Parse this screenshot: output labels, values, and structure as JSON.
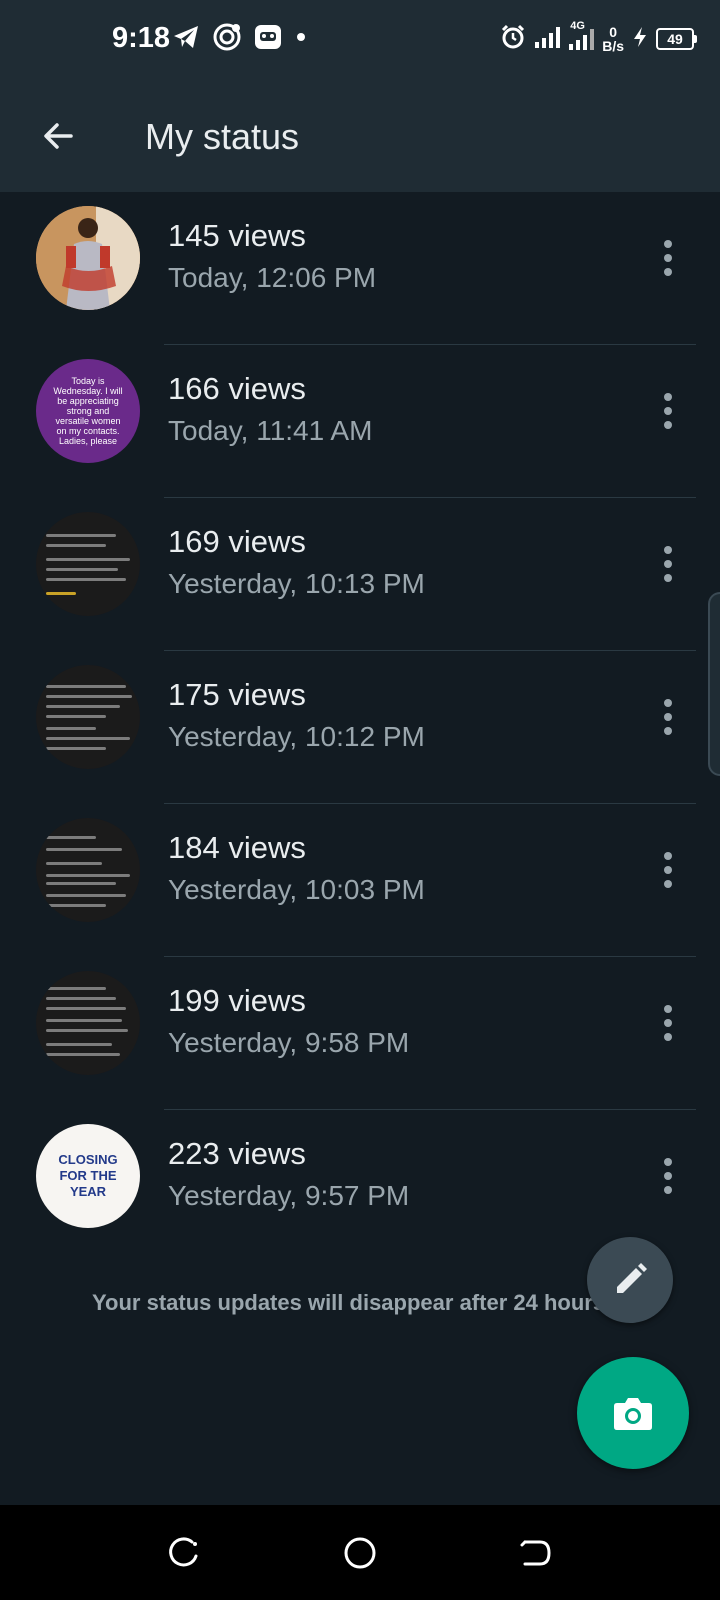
{
  "status_bar": {
    "time": "9:18",
    "network_type": "4G",
    "net_speed_value": "0",
    "net_speed_unit": "B/s",
    "battery": "49",
    "icons": [
      "telegram-icon",
      "ring-app-icon",
      "game-controller-icon",
      "dot-icon",
      "alarm-icon",
      "signal-icon",
      "charging-icon"
    ]
  },
  "app_bar": {
    "title": "My status",
    "back_icon": "arrow-back-icon"
  },
  "statuses": [
    {
      "views": "145 views",
      "time": "Today, 12:06 PM",
      "thumbnail": "photo"
    },
    {
      "views": "166 views",
      "time": "Today, 11:41 AM",
      "thumbnail": "text",
      "thumbnail_text": "Today is Wednesday. I will be appreciating strong and versatile women on my contacts. Ladies, please"
    },
    {
      "views": "169 views",
      "time": "Yesterday, 10:13 PM",
      "thumbnail": "dark-text"
    },
    {
      "views": "175 views",
      "time": "Yesterday, 10:12 PM",
      "thumbnail": "dark-text"
    },
    {
      "views": "184 views",
      "time": "Yesterday, 10:03 PM",
      "thumbnail": "dark-text"
    },
    {
      "views": "199 views",
      "time": "Yesterday, 9:58 PM",
      "thumbnail": "dark-text"
    },
    {
      "views": "223 views",
      "time": "Yesterday, 9:57 PM",
      "thumbnail": "light-text",
      "thumbnail_text": "CLOSING FOR THE YEAR"
    }
  ],
  "footer_note": "Your status updates will disappear after 24 hours",
  "fabs": {
    "edit_icon": "pencil-icon",
    "camera_icon": "camera-icon"
  },
  "nav_bar": {
    "icons": [
      "recents-icon",
      "home-icon",
      "back-icon"
    ]
  },
  "colors": {
    "background": "#121b22",
    "bar": "#1f2c34",
    "accent": "#00a884",
    "text_secondary": "#9aa6ad",
    "thumbnail_purple": "#6a2a8a"
  }
}
